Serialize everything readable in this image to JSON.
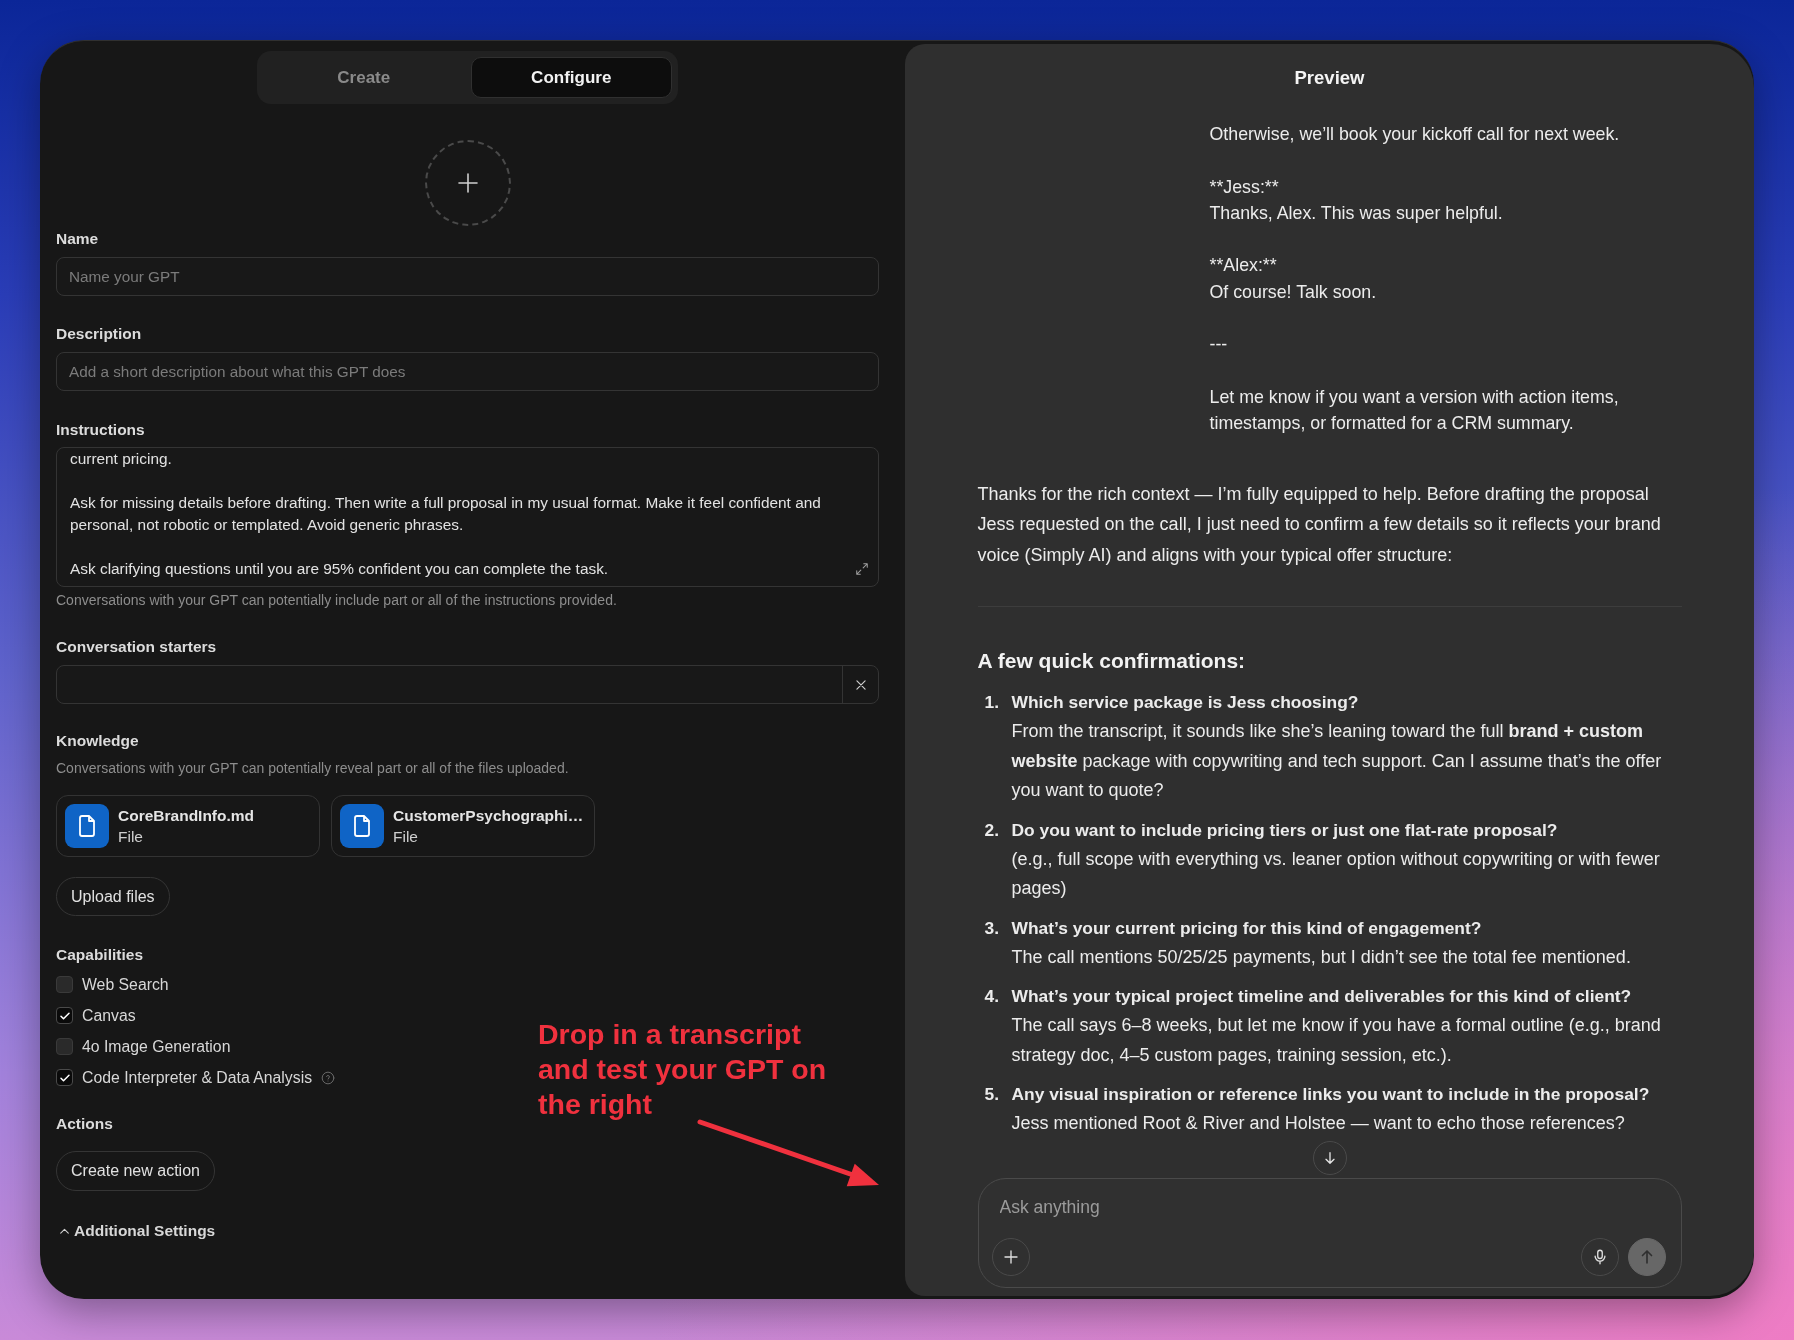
{
  "tabs": [
    {
      "label": "Create",
      "selected": false
    },
    {
      "label": "Configure",
      "selected": true
    }
  ],
  "form": {
    "name": {
      "label": "Name",
      "placeholder": "Name your GPT"
    },
    "description": {
      "label": "Description",
      "placeholder": "Add a short description about what this GPT does"
    },
    "instructions": {
      "label": "Instructions",
      "value": "current pricing.\n\nAsk for missing details before drafting. Then write a full proposal in my usual format. Make it feel confident and personal, not robotic or templated. Avoid generic phrases.\n\nAsk clarifying questions until you are 95% confident you can complete the task.",
      "note": "Conversations with your GPT can potentially include part or all of the instructions provided."
    },
    "conversation_starters": {
      "label": "Conversation starters"
    },
    "knowledge": {
      "label": "Knowledge",
      "note": "Conversations with your GPT can potentially reveal part or all of the files uploaded.",
      "files": [
        {
          "name": "CoreBrandInfo.md",
          "type": "File"
        },
        {
          "name": "CustomerPsychographi…",
          "type": "File"
        }
      ],
      "upload_button": "Upload files"
    },
    "capabilities": {
      "label": "Capabilities",
      "items": [
        {
          "label": "Web Search",
          "checked": false
        },
        {
          "label": "Canvas",
          "checked": true
        },
        {
          "label": "4o Image Generation",
          "checked": false
        },
        {
          "label": "Code Interpreter & Data Analysis",
          "checked": true,
          "help": true
        }
      ]
    },
    "actions": {
      "label": "Actions",
      "button": "Create new action"
    },
    "additional_settings": {
      "label": "Additional Settings"
    }
  },
  "annotation": {
    "text": "Drop in a transcript and test your GPT on the right"
  },
  "preview": {
    "title": "Preview",
    "user_message": "Otherwise, we’ll book your kickoff call for next week.\n\n**Jess:**\nThanks, Alex. This was super helpful.\n\n**Alex:**\nOf course! Talk soon.\n\n---\n\nLet me know if you want a version with action items, timestamps, or formatted for a CRM summary.",
    "assistant": {
      "intro": "Thanks for the rich context — I’m fully equipped to help. Before drafting the proposal Jess requested on the call, I just need to confirm a few details so it reflects your brand voice (Simply AI) and aligns with your typical offer structure:",
      "heading": "A few quick confirmations:",
      "items": [
        {
          "number": "1.",
          "title": "Which service package is Jess choosing?",
          "body": "From the transcript, it sounds like she’s leaning toward the full **brand + custom website** package with copywriting and tech support. Can I assume that’s the offer you want to quote?"
        },
        {
          "number": "2.",
          "title": "Do you want to include pricing tiers or just one flat-rate proposal?",
          "body": "(e.g., full scope with everything vs. leaner option without copywriting or with fewer pages)"
        },
        {
          "number": "3.",
          "title": "What’s your current pricing for this kind of engagement?",
          "body": "The call mentions 50/25/25 payments, but I didn’t see the total fee mentioned."
        },
        {
          "number": "4.",
          "title": "What’s your typical project timeline and deliverables for this kind of client?",
          "body": "The call says 6–8 weeks, but let me know if you have a formal outline (e.g., brand strategy doc, 4–5 custom pages, training session, etc.)."
        },
        {
          "number": "5.",
          "title": "Any visual inspiration or reference links you want to include in the proposal?",
          "body": "Jess mentioned Root & River and Holstee — want to echo those references?"
        }
      ]
    },
    "composer": {
      "placeholder": "Ask anything"
    }
  }
}
